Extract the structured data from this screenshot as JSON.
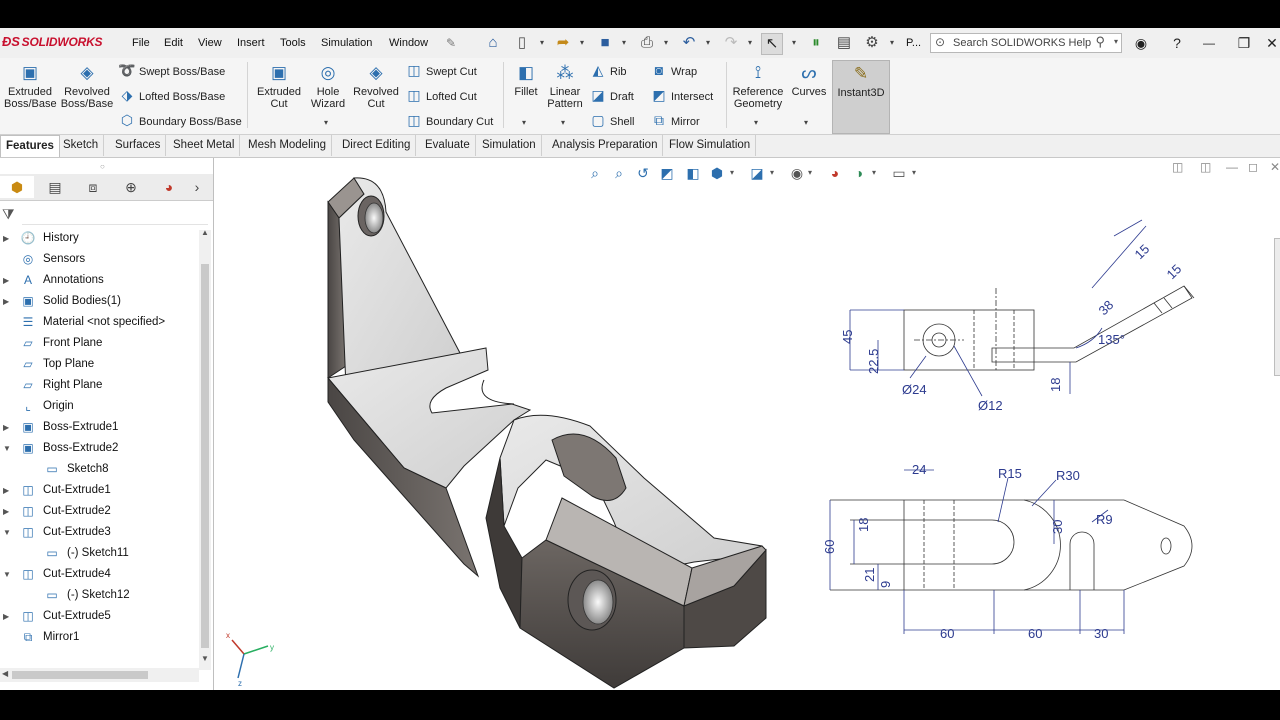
{
  "app": {
    "name": "SOLIDWORKS"
  },
  "menu": [
    "File",
    "Edit",
    "View",
    "Insert",
    "Tools",
    "Simulation",
    "Window"
  ],
  "quick_access": {
    "more_label": "P..."
  },
  "search": {
    "placeholder": "Search SOLIDWORKS Help"
  },
  "ribbon": {
    "extruded_boss": "Extruded\nBoss/Base",
    "revolved_boss": "Revolved\nBoss/Base",
    "swept_boss": "Swept Boss/Base",
    "lofted_boss": "Lofted Boss/Base",
    "boundary_boss": "Boundary Boss/Base",
    "extruded_cut": "Extruded\nCut",
    "hole_wizard": "Hole\nWizard",
    "revolved_cut": "Revolved\nCut",
    "swept_cut": "Swept Cut",
    "lofted_cut": "Lofted Cut",
    "boundary_cut": "Boundary Cut",
    "fillet": "Fillet",
    "linear_pattern": "Linear\nPattern",
    "rib": "Rib",
    "draft": "Draft",
    "shell": "Shell",
    "wrap": "Wrap",
    "intersect": "Intersect",
    "mirror": "Mirror",
    "reference_geometry": "Reference\nGeometry",
    "curves": "Curves",
    "instant3d": "Instant3D"
  },
  "tabs": [
    "Features",
    "Sketch",
    "Surfaces",
    "Sheet Metal",
    "Mesh Modeling",
    "Direct Editing",
    "Evaluate",
    "Simulation",
    "Analysis Preparation",
    "Flow Simulation"
  ],
  "active_tab": "Features",
  "tree": [
    {
      "label": "History",
      "icon": "history-icon",
      "expand": true
    },
    {
      "label": "Sensors",
      "icon": "sensor-icon",
      "expand": false
    },
    {
      "label": "Annotations",
      "icon": "annotation-icon",
      "expand": true
    },
    {
      "label": "Solid Bodies(1)",
      "icon": "solid-bodies-icon",
      "expand": true
    },
    {
      "label": "Material <not specified>",
      "icon": "material-icon",
      "expand": false
    },
    {
      "label": "Front Plane",
      "icon": "plane-icon",
      "expand": false
    },
    {
      "label": "Top Plane",
      "icon": "plane-icon",
      "expand": false
    },
    {
      "label": "Right Plane",
      "icon": "plane-icon",
      "expand": false
    },
    {
      "label": "Origin",
      "icon": "origin-icon",
      "expand": false
    },
    {
      "label": "Boss-Extrude1",
      "icon": "extrude-icon",
      "expand": true
    },
    {
      "label": "Boss-Extrude2",
      "icon": "extrude-icon",
      "expand": true,
      "open": true
    },
    {
      "label": "Sketch8",
      "icon": "sketch-icon",
      "child": true
    },
    {
      "label": "Cut-Extrude1",
      "icon": "cut-icon",
      "expand": true
    },
    {
      "label": "Cut-Extrude2",
      "icon": "cut-icon",
      "expand": true
    },
    {
      "label": "Cut-Extrude3",
      "icon": "cut-icon",
      "expand": true,
      "open": true
    },
    {
      "label": "(-) Sketch11",
      "icon": "sketch-icon",
      "child": true
    },
    {
      "label": "Cut-Extrude4",
      "icon": "cut-icon",
      "expand": true,
      "open": true
    },
    {
      "label": "(-) Sketch12",
      "icon": "sketch-icon",
      "child": true
    },
    {
      "label": "Cut-Extrude5",
      "icon": "cut-icon",
      "expand": true
    },
    {
      "label": "Mirror1",
      "icon": "mirror-icon",
      "expand": false
    }
  ],
  "drawing": {
    "front": {
      "height": "45",
      "center_height": "22.5",
      "base": "18",
      "boss_dia": "Ø24",
      "hole_dia": "Ø12",
      "arm_angle": "135°",
      "arm_length": "38",
      "arm_width_a": "15",
      "arm_width_b": "15"
    },
    "top": {
      "slot_width": "24",
      "boss_radius": "R15",
      "outer_radius": "R30",
      "slot_radius": "R9",
      "width": "60",
      "slot_gap": "18",
      "offset_a": "21",
      "offset_b": "9",
      "slot_depth": "30",
      "len_a": "60",
      "len_b": "60",
      "len_c": "30"
    }
  },
  "triad": {
    "x": "x",
    "y": "y",
    "z": "z"
  }
}
